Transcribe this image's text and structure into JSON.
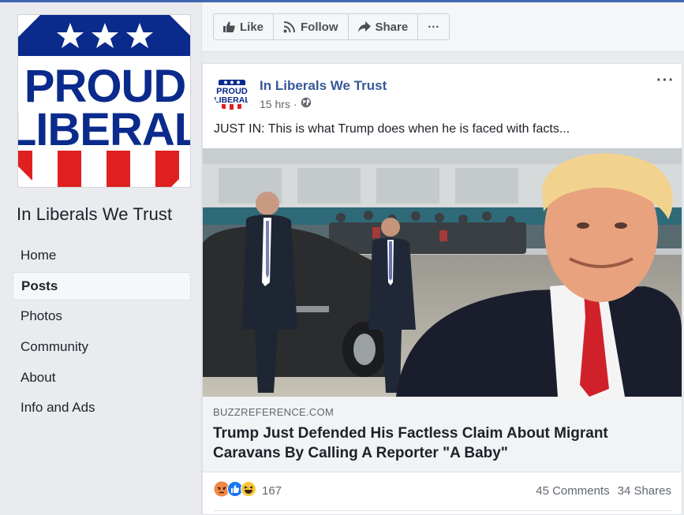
{
  "page": {
    "name": "In Liberals We Trust",
    "logo_line1": "PROUD",
    "logo_line2": "LIBERAL"
  },
  "sidebar": {
    "items": [
      {
        "label": "Home"
      },
      {
        "label": "Posts",
        "active": true
      },
      {
        "label": "Photos"
      },
      {
        "label": "Community"
      },
      {
        "label": "About"
      },
      {
        "label": "Info and Ads"
      }
    ]
  },
  "action_bar": {
    "like_label": "Like",
    "follow_label": "Follow",
    "share_label": "Share",
    "more_label": "···"
  },
  "post": {
    "author": "In Liberals We Trust",
    "time": "15 hrs",
    "separator": "·",
    "text": "JUST IN: This is what Trump does when he is faced with facts...",
    "menu_label": "···",
    "link": {
      "domain": "BUZZREFERENCE.COM",
      "title": "Trump Just Defended His Factless Claim About Migrant Caravans By Calling A Reporter \"A Baby\""
    },
    "reactions": {
      "icons": [
        "angry-reaction-icon",
        "like-reaction-icon",
        "haha-reaction-icon"
      ],
      "count": "167"
    },
    "comments": "45 Comments",
    "shares": "34 Shares"
  },
  "colors": {
    "facebook_blue": "#4267b2",
    "link_blue": "#365899",
    "logo_blue": "#0a2a8c",
    "logo_red": "#e02020",
    "tie_red": "#d0212a"
  }
}
